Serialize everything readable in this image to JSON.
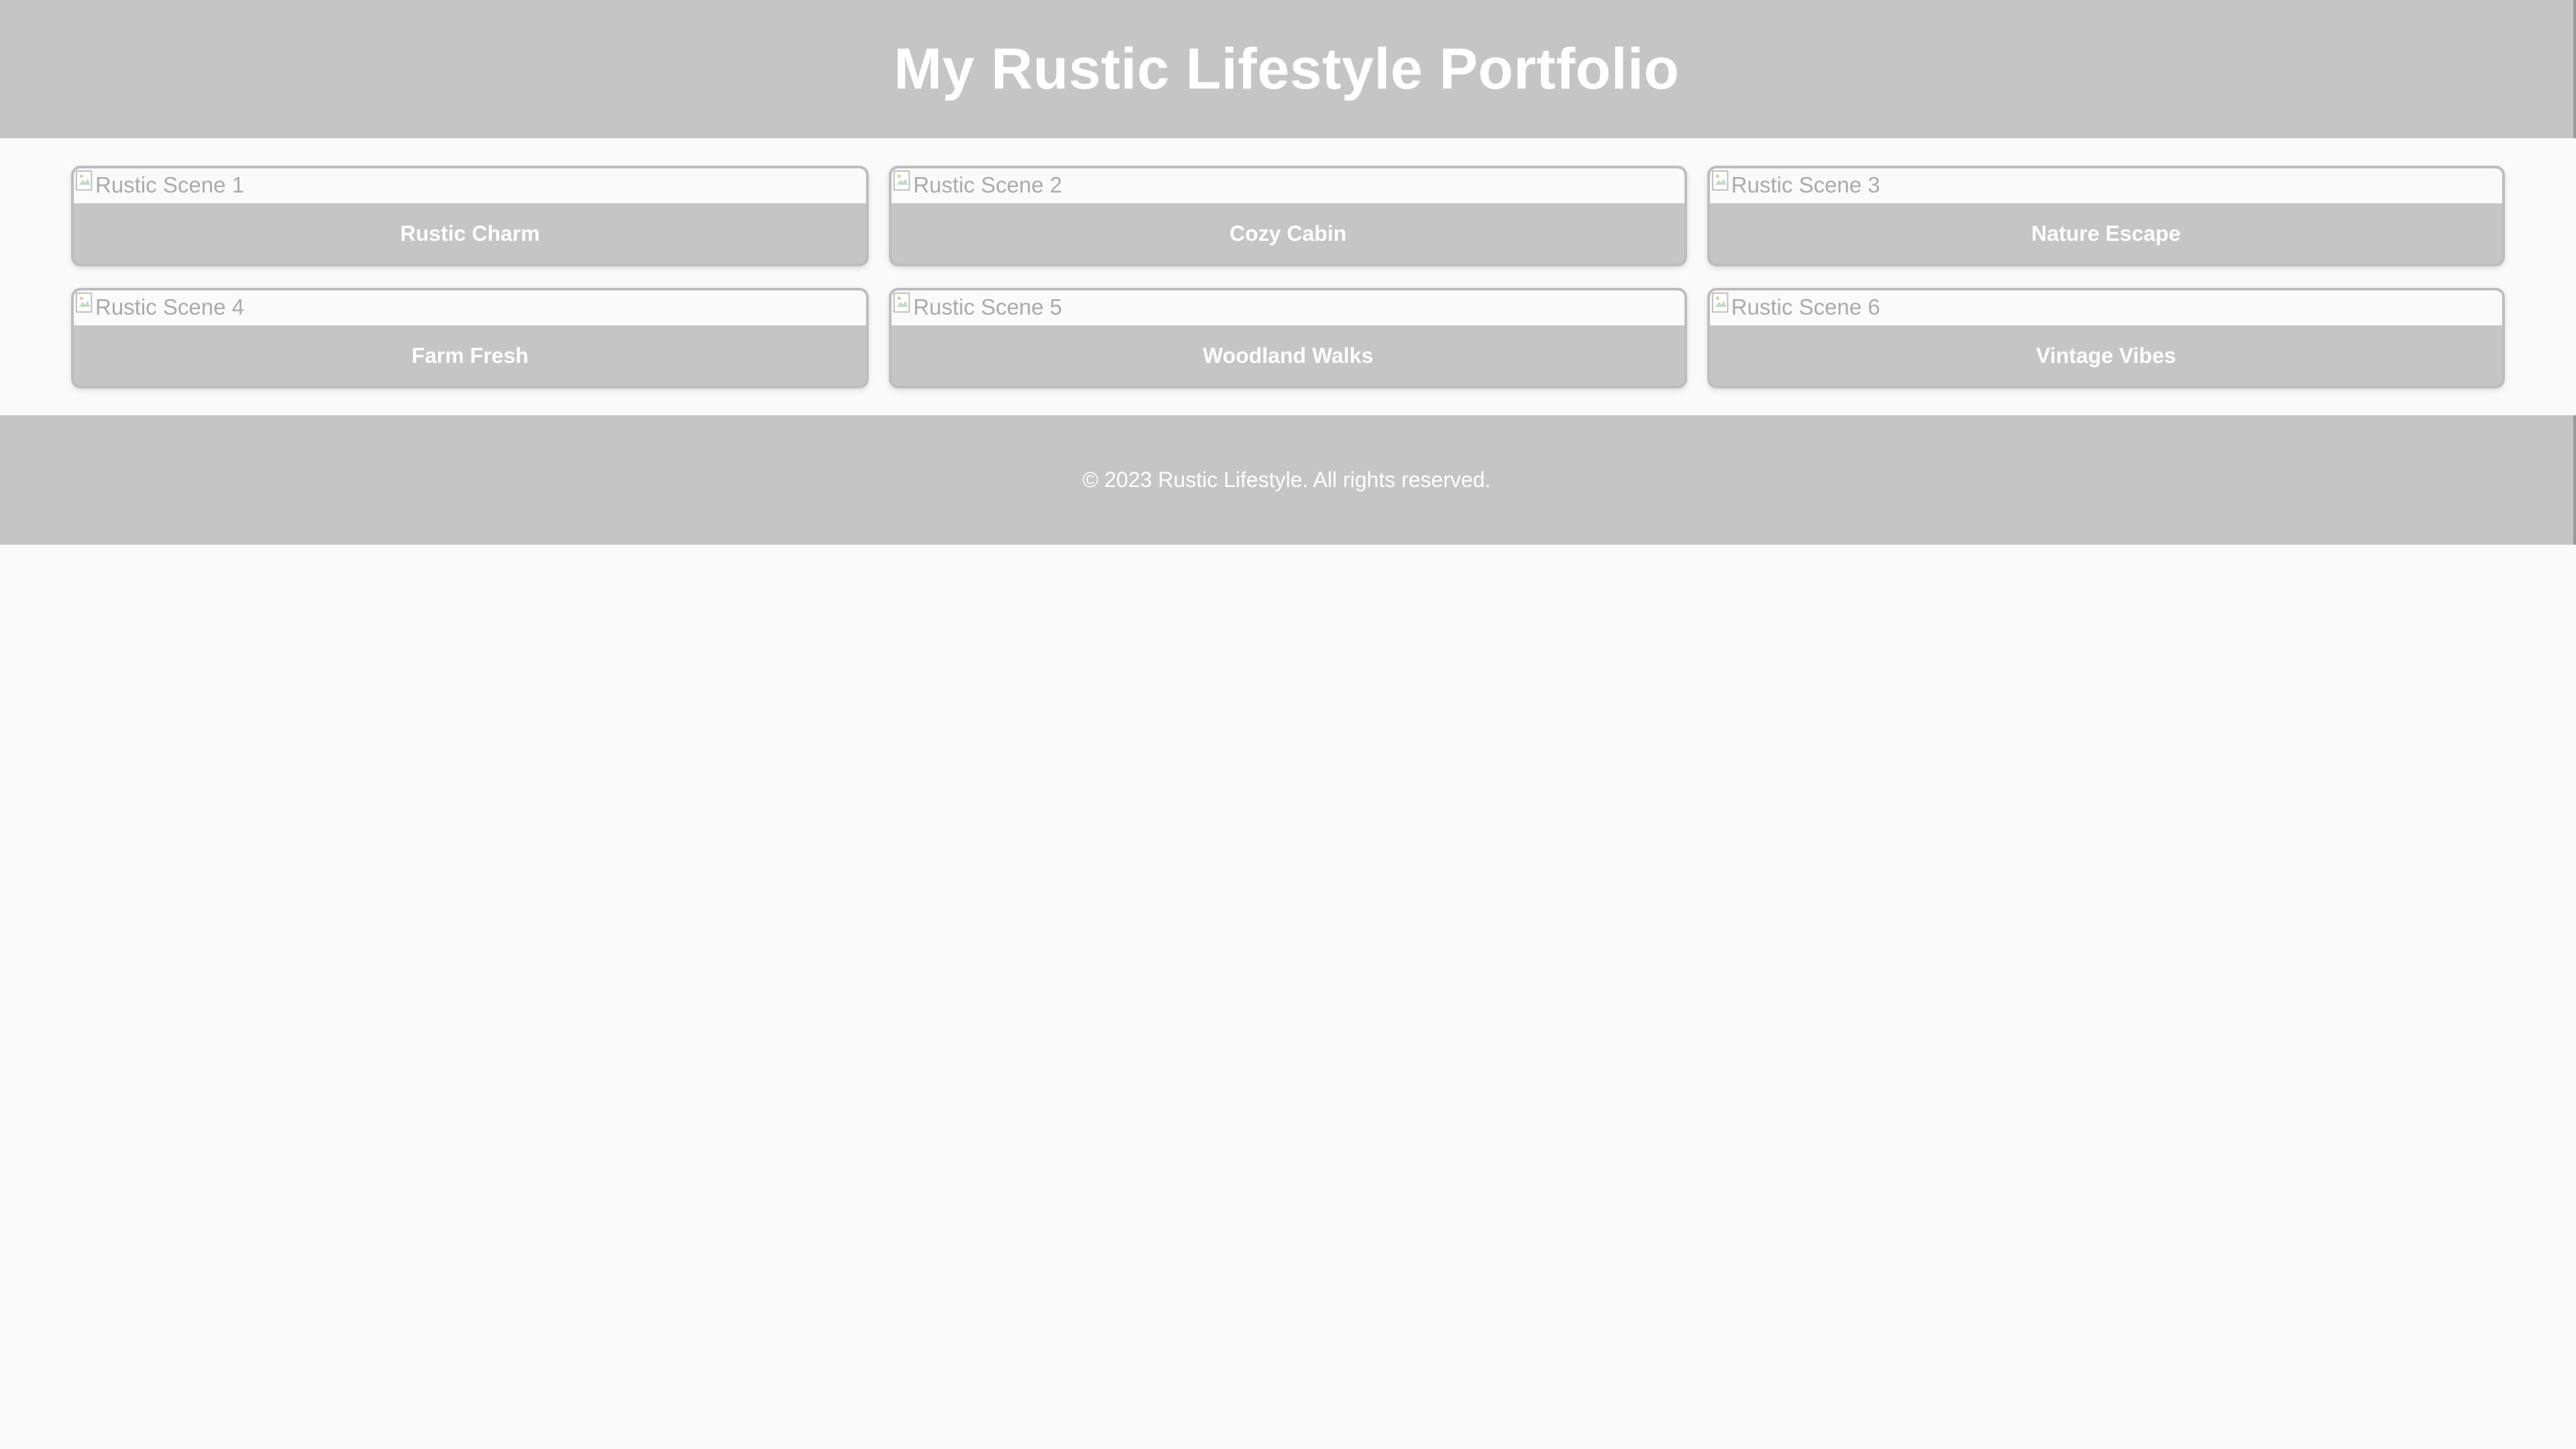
{
  "header": {
    "title": "My Rustic Lifestyle Portfolio"
  },
  "gallery": {
    "items": [
      {
        "alt": "Rustic Scene 1",
        "caption": "Rustic Charm"
      },
      {
        "alt": "Rustic Scene 2",
        "caption": "Cozy Cabin"
      },
      {
        "alt": "Rustic Scene 3",
        "caption": "Nature Escape"
      },
      {
        "alt": "Rustic Scene 4",
        "caption": "Farm Fresh"
      },
      {
        "alt": "Rustic Scene 5",
        "caption": "Woodland Walks"
      },
      {
        "alt": "Rustic Scene 6",
        "caption": "Vintage Vibes"
      }
    ]
  },
  "footer": {
    "copyright": "© 2023 Rustic Lifestyle. All rights reserved."
  },
  "colors": {
    "header_bg": "#c5c5c5",
    "page_bg": "#fafafa",
    "text_light": "#ffffff",
    "alt_text": "#ababab"
  },
  "icons": {
    "image_placeholder": "broken-image-icon"
  }
}
